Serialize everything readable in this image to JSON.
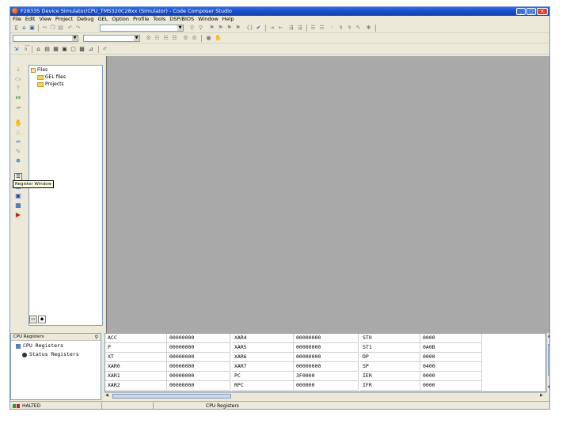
{
  "window": {
    "title": "F28335 Device Simulator/CPU_TMS320C28xx (Simulator) - Code Composer Studio",
    "controls": {
      "minimize": "_",
      "maximize": "□",
      "close": "×"
    }
  },
  "menu": [
    "File",
    "Edit",
    "View",
    "Project",
    "Debug",
    "GEL",
    "Option",
    "Profile",
    "Tools",
    "DSP/BIOS",
    "Window",
    "Help"
  ],
  "icons": {
    "toolbar1": [
      "new-file-icon",
      "open-icon",
      "save-icon",
      "cut-icon",
      "copy-icon",
      "paste-icon",
      "undo-icon",
      "redo-icon"
    ],
    "left_toolbar": [
      "step-into-icon",
      "step-over-icon",
      "step-out-icon",
      "run-to-cursor-icon",
      "run-icon",
      "halt-icon",
      "animate-icon",
      "breakpoint-icon",
      "probe-point-icon",
      "profile-icon",
      "register-window-icon",
      "memory-window-icon",
      "watch-window-icon",
      "disassembly-icon",
      "mixed-mode-icon"
    ]
  },
  "tooltip": "Register Window",
  "project_tree": {
    "root": "Files",
    "children": [
      "GEL files",
      "Projects"
    ]
  },
  "panel_tabs": [
    "file-view-tab",
    "bookmark-tab"
  ],
  "register_tree": {
    "title": "CPU Registers",
    "nodes": [
      "CPU Registers",
      "Status Registers"
    ]
  },
  "registers": {
    "columns": [
      [
        {
          "name": "ACC",
          "value": "00000000"
        },
        {
          "name": "P",
          "value": "00000000"
        },
        {
          "name": "XT",
          "value": "00000000"
        },
        {
          "name": "XAR0",
          "value": "00000000"
        },
        {
          "name": "XAR1",
          "value": "00000000"
        },
        {
          "name": "XAR2",
          "value": "00000000"
        }
      ],
      [
        {
          "name": "XAR4",
          "value": "00000000"
        },
        {
          "name": "XAR5",
          "value": "00000000"
        },
        {
          "name": "XAR6",
          "value": "00000000"
        },
        {
          "name": "XAR7",
          "value": "00000000"
        },
        {
          "name": "PC",
          "value": "3F0000"
        },
        {
          "name": "RPC",
          "value": "000000"
        }
      ],
      [
        {
          "name": "ST0",
          "value": "0000"
        },
        {
          "name": "ST1",
          "value": "0A0B"
        },
        {
          "name": "DP",
          "value": "0000"
        },
        {
          "name": "SP",
          "value": "0400"
        },
        {
          "name": "IER",
          "value": "0000"
        },
        {
          "name": "IFR",
          "value": "0000"
        }
      ]
    ]
  },
  "status": {
    "state": "HALTED",
    "active_window": "CPU Registers"
  }
}
